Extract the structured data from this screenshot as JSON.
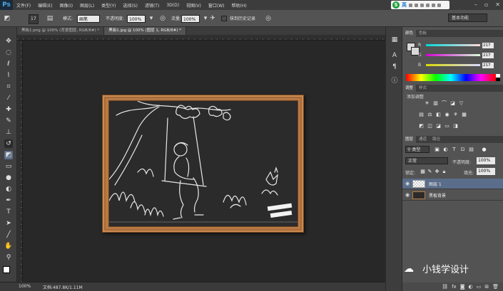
{
  "app": {
    "logo": "Ps"
  },
  "menu": [
    "文件(F)",
    "编辑(E)",
    "图像(I)",
    "图层(L)",
    "类型(Y)",
    "选择(S)",
    "滤镜(T)",
    "3D(D)",
    "视图(V)",
    "窗口(W)",
    "帮助(H)"
  ],
  "ime": {
    "lang": "英"
  },
  "options": {
    "brush_size": "17",
    "mode_label": "模式:",
    "mode_value": "画笔",
    "opacity_label": "不透明度:",
    "opacity_value": "100%",
    "flow_label": "流量:",
    "flow_value": "100%",
    "history_label": "抹到历史记录",
    "workspace": "基本功能"
  },
  "tabs": [
    {
      "label": "黑板1.png @ 100% (背景图层, RGB/8#) *",
      "active": false
    },
    {
      "label": "黑板1.jpg @ 100% (图层 1, RGB/8#) *",
      "active": true
    }
  ],
  "status": {
    "zoom": "100%",
    "doc": "文档:487.8K/1.11M"
  },
  "panels": {
    "color_tabs": [
      "颜色",
      "色板"
    ],
    "color": {
      "r_label": "R",
      "g_label": "G",
      "b_label": "B",
      "r": "217",
      "g": "217",
      "b": "217"
    },
    "adjust_tabs": [
      "调整",
      "样式"
    ],
    "adjust_title": "添加调整",
    "layers_tabs": [
      "图层",
      "通道",
      "路径"
    ],
    "kind_label": "类型",
    "blend_mode": "正常",
    "opacity_label": "不透明度:",
    "opacity_value": "100%",
    "lock_label": "锁定:",
    "fill_label": "填充:",
    "fill_value": "100%",
    "layers": [
      {
        "name": "图层 1",
        "selected": true
      },
      {
        "name": "黑板背景",
        "selected": false
      }
    ]
  },
  "watermark": {
    "text": "小钱学设计"
  },
  "colors": {
    "accent_selected_layer": "#5a6d8a",
    "frame_wood": "#b77a45",
    "board": "#2b2b2b"
  }
}
